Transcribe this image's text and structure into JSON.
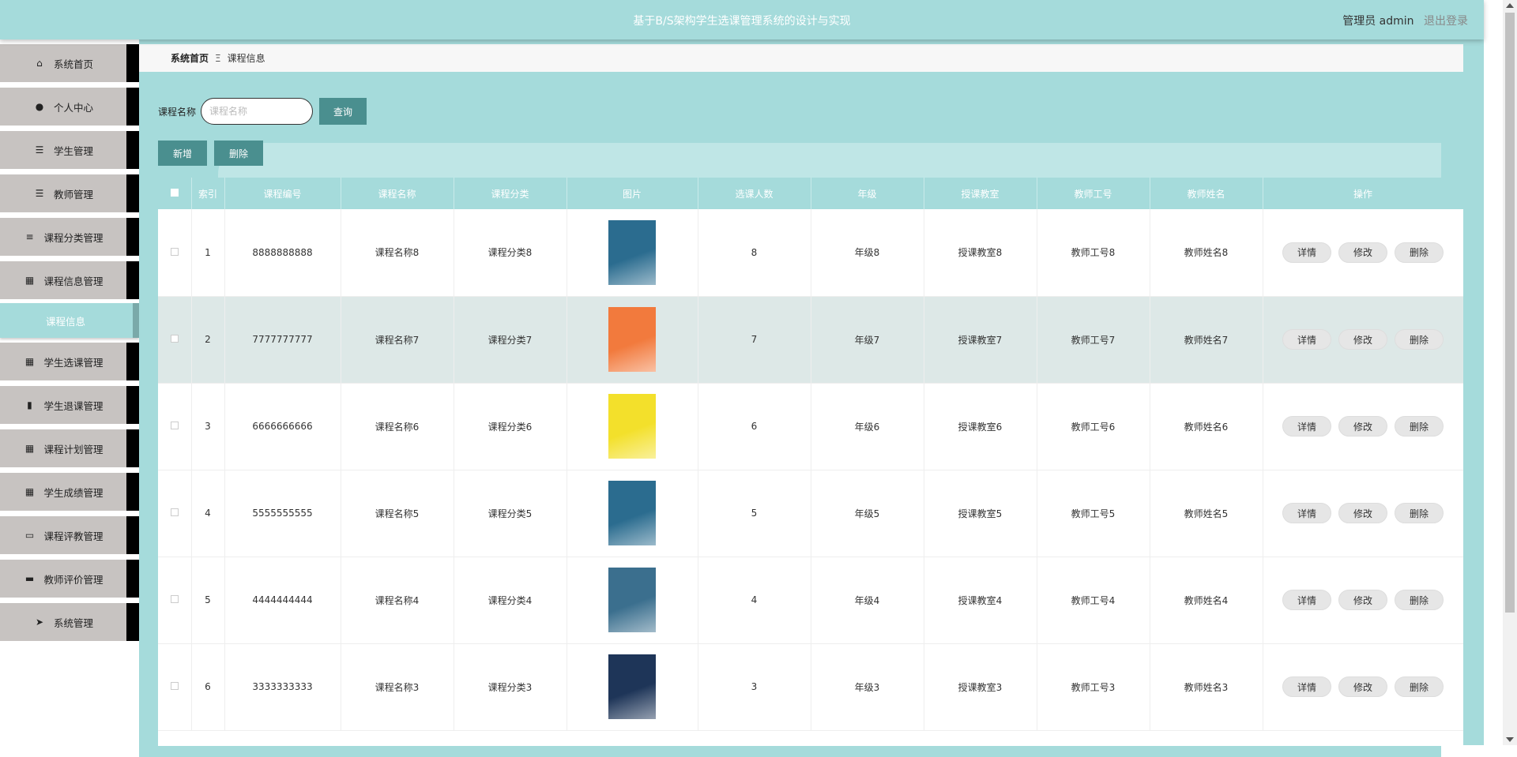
{
  "header": {
    "title": "基于B/S架构学生选课管理系统的设计与实现",
    "user_label": "管理员 admin",
    "logout_label": "退出登录"
  },
  "sidebar": {
    "items": [
      {
        "label": "系统首页",
        "icon": "home-icon",
        "glyph": "⌂"
      },
      {
        "label": "个人中心",
        "icon": "user-icon",
        "glyph": "●"
      },
      {
        "label": "学生管理",
        "icon": "list-icon",
        "glyph": "☰"
      },
      {
        "label": "教师管理",
        "icon": "list-icon",
        "glyph": "☰"
      },
      {
        "label": "课程分类管理",
        "icon": "sliders-icon",
        "glyph": "≡"
      },
      {
        "label": "课程信息管理",
        "icon": "grid-icon",
        "glyph": "▦"
      },
      {
        "label": "课程信息",
        "icon": "",
        "glyph": "",
        "sub": true
      },
      {
        "label": "学生选课管理",
        "icon": "grid-icon",
        "glyph": "▦"
      },
      {
        "label": "学生退课管理",
        "icon": "book-icon",
        "glyph": "▮"
      },
      {
        "label": "课程计划管理",
        "icon": "grid-icon",
        "glyph": "▦"
      },
      {
        "label": "学生成绩管理",
        "icon": "grid-icon",
        "glyph": "▦"
      },
      {
        "label": "课程评教管理",
        "icon": "monitor-icon",
        "glyph": "▭"
      },
      {
        "label": "教师评价管理",
        "icon": "printer-icon",
        "glyph": "▬"
      },
      {
        "label": "系统管理",
        "icon": "send-icon",
        "glyph": "➤"
      }
    ]
  },
  "breadcrumb": {
    "home": "系统首页",
    "separator": "Ξ",
    "current": "课程信息"
  },
  "search": {
    "label": "课程名称",
    "placeholder": "课程名称",
    "button": "查询"
  },
  "actions": {
    "add": "新增",
    "delete": "删除"
  },
  "table": {
    "columns": [
      "索引",
      "课程编号",
      "课程名称",
      "课程分类",
      "图片",
      "选课人数",
      "年级",
      "授课教室",
      "教师工号",
      "教师姓名",
      "操作"
    ],
    "row_actions": {
      "detail": "详情",
      "edit": "修改",
      "delete": "删除"
    },
    "rows": [
      {
        "index": "1",
        "code": "8888888888",
        "name": "课程名称8",
        "category": "课程分类8",
        "count": "8",
        "grade": "年级8",
        "room": "授课教室8",
        "teacher_id": "教师工号8",
        "teacher_name": "教师姓名8",
        "cover": "#2b6c8f"
      },
      {
        "index": "2",
        "code": "7777777777",
        "name": "课程名称7",
        "category": "课程分类7",
        "count": "7",
        "grade": "年级7",
        "room": "授课教室7",
        "teacher_id": "教师工号7",
        "teacher_name": "教师姓名7",
        "cover": "#f27a3d"
      },
      {
        "index": "3",
        "code": "6666666666",
        "name": "课程名称6",
        "category": "课程分类6",
        "count": "6",
        "grade": "年级6",
        "room": "授课教室6",
        "teacher_id": "教师工号6",
        "teacher_name": "教师姓名6",
        "cover": "#f3e02b"
      },
      {
        "index": "4",
        "code": "5555555555",
        "name": "课程名称5",
        "category": "课程分类5",
        "count": "5",
        "grade": "年级5",
        "room": "授课教室5",
        "teacher_id": "教师工号5",
        "teacher_name": "教师姓名5",
        "cover": "#2b6c8f"
      },
      {
        "index": "5",
        "code": "4444444444",
        "name": "课程名称4",
        "category": "课程分类4",
        "count": "4",
        "grade": "年级4",
        "room": "授课教室4",
        "teacher_id": "教师工号4",
        "teacher_name": "教师姓名4",
        "cover": "#3b6f8e"
      },
      {
        "index": "6",
        "code": "3333333333",
        "name": "课程名称3",
        "category": "课程分类3",
        "count": "3",
        "grade": "年级3",
        "room": "授课教室3",
        "teacher_id": "教师工号3",
        "teacher_name": "教师姓名3",
        "cover": "#1e3558"
      }
    ]
  }
}
